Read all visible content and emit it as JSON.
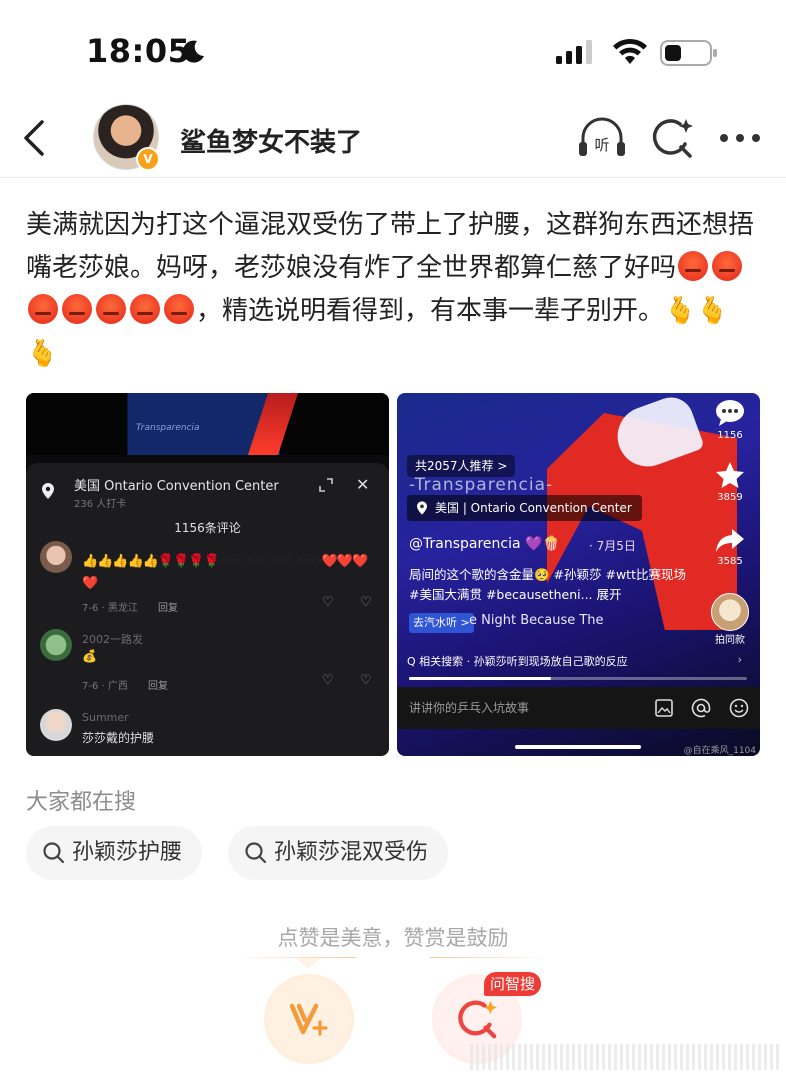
{
  "status_bar": {
    "time": "18:05"
  },
  "header": {
    "nickname": "鲨鱼梦女不装了",
    "verified_badge": "V"
  },
  "post": {
    "text_part1": "美满就因为打这个逼混双受伤了带上了护腰，这群狗东西还想捂嘴老莎娘。妈呀，老莎娘没有炸了全世界都算仁慈了好吗",
    "angry_emoji_count": 7,
    "text_part2": "，精选说明看得到，有本事一辈子别开。",
    "hand_emoji": "🫰",
    "hand_emoji_count": 3
  },
  "image1": {
    "stage_watermark": "Transparencia",
    "location": "美国  Ontario Convention Center",
    "checkins": "236 人打卡",
    "comment_count": "1156条评论",
    "comments": [
      {
        "name": "",
        "text": "👍👍👍👍👍🌹🌹🌹🌹 666 666 666 666 ❤️❤️❤️❤️",
        "date": "7-6 · 黑龙江",
        "reply": "回复"
      },
      {
        "name": "2002一路发",
        "text": "💰",
        "date": "7-6 · 广西",
        "reply": "回复"
      },
      {
        "name": "Summer",
        "text": "莎莎戴的护腰"
      }
    ]
  },
  "image2": {
    "recommend": "共2057人推荐 >",
    "watermark": "-Transparencia-",
    "location": "美国 | Ontario Convention Center",
    "handle": "@Transparencia 💜🍿",
    "date": "· 7月5日",
    "desc": "局间的这个歌的含金量🥺 #孙颖莎 #wtt比赛现场 #美国大满贯 #becausetheni...  展开",
    "qishui_tag": "去汽水听 >",
    "music": "e Night   Because The",
    "comments_count": "1156",
    "likes": "3859",
    "shares": "3585",
    "same_style": "拍同款",
    "related_search": "Q 相关搜索 · 孙颖莎听到现场放自己歌的反应",
    "input_placeholder": "讲讲你的乒乓入坑故事",
    "credit": "@自在乘风_1104"
  },
  "hot_search": {
    "title": "大家都在搜",
    "chips": [
      "孙颖莎护腰",
      "孙颖莎混双受伤"
    ]
  },
  "footer": {
    "tip": "点赞是美意，赞赏是鼓励",
    "ask_tag": "问智搜"
  }
}
